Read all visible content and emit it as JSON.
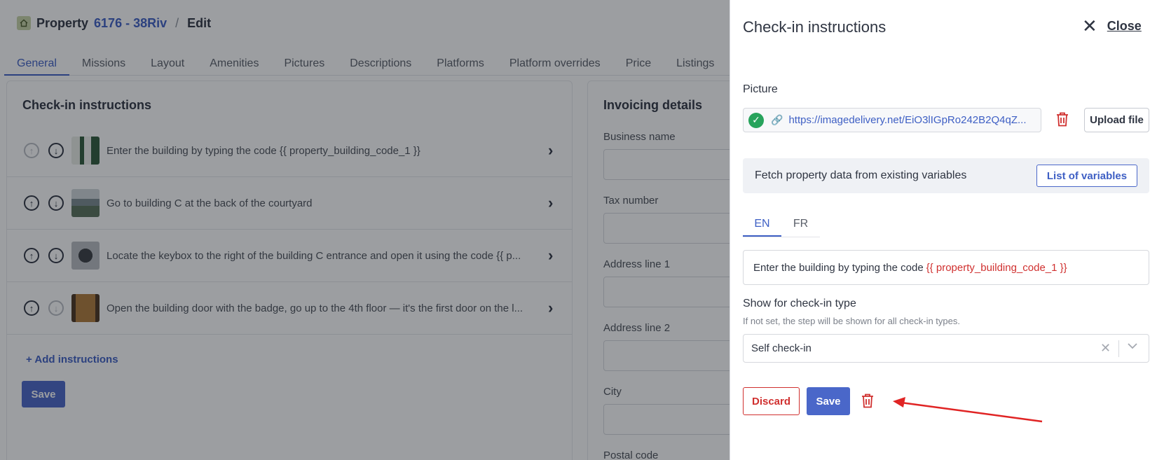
{
  "header": {
    "title": "Property",
    "property_link": "6176 - 38Riv",
    "separator": "/",
    "current": "Edit"
  },
  "tabs": [
    "General",
    "Missions",
    "Layout",
    "Amenities",
    "Pictures",
    "Descriptions",
    "Platforms",
    "Platform overrides",
    "Price",
    "Listings"
  ],
  "checkin_card": {
    "title": "Check-in instructions",
    "steps": [
      "Enter the building by typing the code {{ property_building_code_1 }}",
      "Go to building C at the back of the courtyard",
      "Locate the keybox to the right of the building C entrance and open it using the code {{ p...",
      "Open the building door with the badge, go up to the 4th floor — it's the first door on the l..."
    ],
    "add_label": "+ Add instructions",
    "save_label": "Save"
  },
  "invoicing_card": {
    "title": "Invoicing details",
    "fields": [
      "Business name",
      "Tax number",
      "Address line 1",
      "Address line 2",
      "City",
      "Postal code"
    ]
  },
  "drawer": {
    "title": "Check-in instructions",
    "close_label": "Close",
    "picture_label": "Picture",
    "picture_url": "https://imagedelivery.net/EiO3lIGpRo242B2Q4qZ...",
    "upload_label": "Upload file",
    "fetch_text": "Fetch property data from existing variables",
    "variables_button": "List of variables",
    "lang_tabs": [
      "EN",
      "FR"
    ],
    "editor_text": "Enter the building by typing the code",
    "editor_variable": "{{ property_building_code_1 }}",
    "show_label": "Show for check-in type",
    "show_hint": "If not set, the step will be shown for all check-in types.",
    "select_value": "Self check-in",
    "discard_label": "Discard",
    "save_label": "Save"
  },
  "colors": {
    "accent": "#3e5fc4",
    "primary_button": "#4a67c9",
    "danger": "#d0302f",
    "success": "#27a35c"
  }
}
